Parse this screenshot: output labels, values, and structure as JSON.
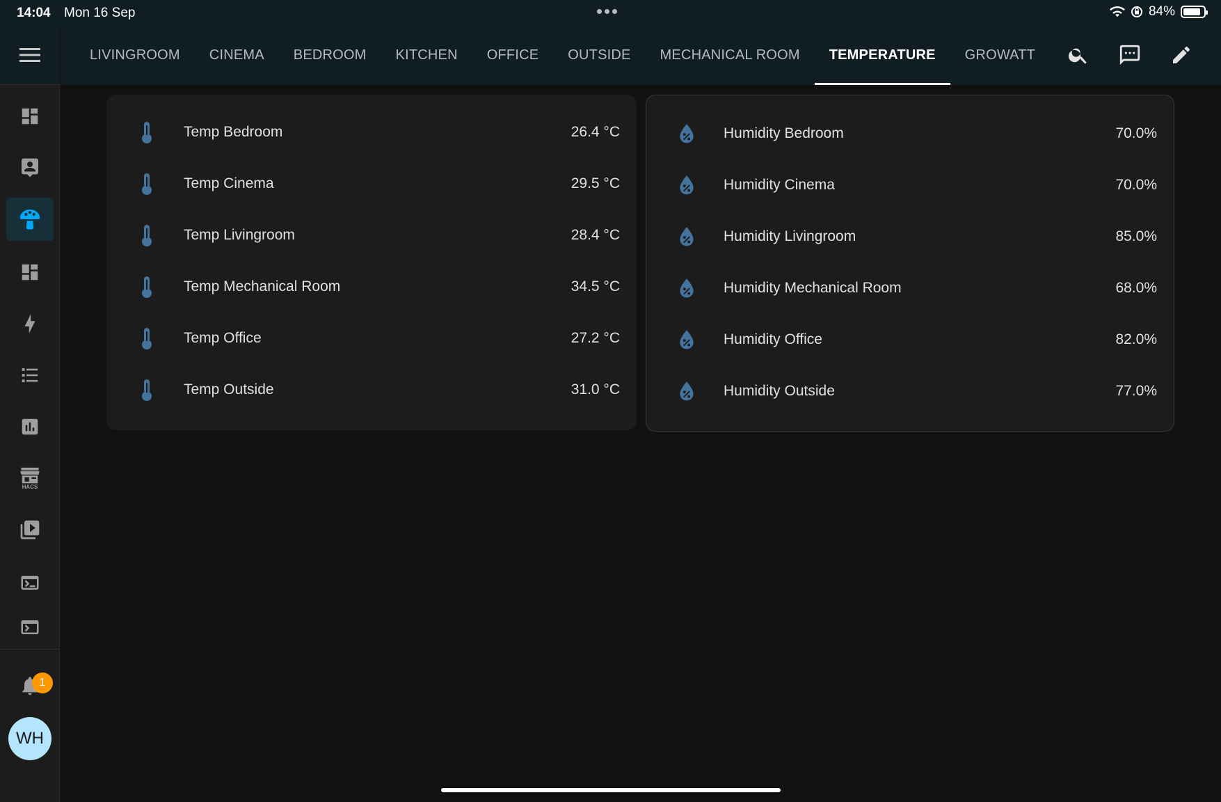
{
  "status": {
    "time": "14:04",
    "date": "Mon 16 Sep",
    "battery": "84%"
  },
  "tabs": [
    "LIVINGROOM",
    "CINEMA",
    "BEDROOM",
    "KITCHEN",
    "OFFICE",
    "OUTSIDE",
    "MECHANICAL ROOM",
    "TEMPERATURE",
    "GROWATT"
  ],
  "active_tab": "TEMPERATURE",
  "temperature": [
    {
      "name": "Temp Bedroom",
      "value": "26.4 °C"
    },
    {
      "name": "Temp Cinema",
      "value": "29.5 °C"
    },
    {
      "name": "Temp Livingroom",
      "value": "28.4 °C"
    },
    {
      "name": "Temp Mechanical Room",
      "value": "34.5 °C"
    },
    {
      "name": "Temp Office",
      "value": "27.2 °C"
    },
    {
      "name": "Temp Outside",
      "value": "31.0 °C"
    }
  ],
  "humidity": [
    {
      "name": "Humidity Bedroom",
      "value": "70.0%"
    },
    {
      "name": "Humidity Cinema",
      "value": "70.0%"
    },
    {
      "name": "Humidity Livingroom",
      "value": "85.0%"
    },
    {
      "name": "Humidity Mechanical Room",
      "value": "68.0%"
    },
    {
      "name": "Humidity Office",
      "value": "82.0%"
    },
    {
      "name": "Humidity Outside",
      "value": "77.0%"
    }
  ],
  "sidebar": {
    "items": [
      "dashboard-icon",
      "person-card-icon",
      "mushroom-icon",
      "dashboard-icon",
      "energy-icon",
      "logbook-icon",
      "history-icon",
      "hacs-icon",
      "media-icon",
      "terminal-icon",
      "terminal-icon"
    ],
    "hacs_label": "HACS",
    "notification_count": "1",
    "user_initials": "WH"
  },
  "colors": {
    "accent": "#03a9f4",
    "icon": "#44739e",
    "header": "#101e24"
  }
}
